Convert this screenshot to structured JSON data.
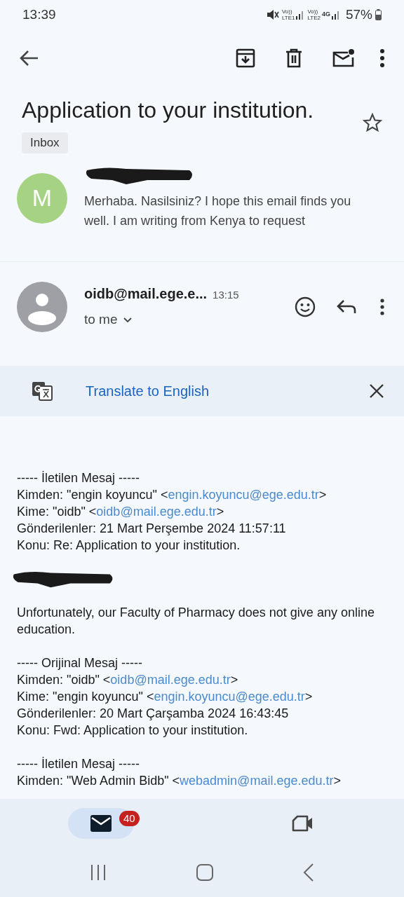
{
  "status_bar": {
    "time": "13:39",
    "networks": [
      {
        "top": "Vo))",
        "bottom": "LTE1"
      },
      {
        "top": "Vo))",
        "bottom": "LTE2",
        "extra": "4G"
      }
    ],
    "battery": "57%"
  },
  "subject": "Application to your institution.",
  "label": "Inbox",
  "starred": false,
  "messages": [
    {
      "kind": "collapsed",
      "avatar_letter": "M",
      "color": "#a5d383",
      "sender_redacted": true,
      "snippet": "Merhaba. Nasilsiniz? I hope this email finds you well. I am writing from Kenya to request"
    },
    {
      "kind": "expanded",
      "sender": "oidb@mail.ege.e...",
      "time": "13:15",
      "recipient": "to me"
    }
  ],
  "translate": {
    "label": "Translate to English"
  },
  "body": [
    [
      {
        "kind": "text",
        "text": "----- İletilen Mesaj -----"
      },
      {
        "kind": "email",
        "prefix": "Kimden: \"engin koyuncu\" <",
        "link": "engin.koyuncu@ege.edu.tr",
        "suffix": ">"
      },
      {
        "kind": "email",
        "prefix": "Kime: \"oidb\" <",
        "link": "oidb@mail.ege.edu.tr",
        "suffix": ">"
      },
      {
        "kind": "text",
        "text": "Gönderilenler: 21 Mart Perşembe 2024 11:57:11"
      },
      {
        "kind": "text",
        "text": "Konu: Re: Application to your institution."
      }
    ],
    [
      {
        "kind": "redacted"
      }
    ],
    [
      {
        "kind": "text",
        "text": "Unfortunately, our Faculty of Pharmacy does not give any online education."
      }
    ],
    [
      {
        "kind": "text",
        "text": "----- Orijinal Mesaj -----"
      },
      {
        "kind": "email",
        "prefix": "Kimden: \"oidb\" <",
        "link": "oidb@mail.ege.edu.tr",
        "suffix": ">"
      },
      {
        "kind": "email",
        "prefix": "Kime: \"engin koyuncu\" <",
        "link": "engin.koyuncu@ege.edu.tr",
        "suffix": ">"
      },
      {
        "kind": "text",
        "text": "Gönderilenler: 20 Mart Çarşamba 2024 16:43:45"
      },
      {
        "kind": "text",
        "text": "Konu: Fwd: Application to your institution."
      }
    ],
    [
      {
        "kind": "text",
        "text": "----- İletilen Mesaj -----"
      },
      {
        "kind": "email",
        "prefix": "Kimden: \"Web Admin Bidb\" <",
        "link": "webadmin@mail.ege.edu.tr",
        "suffix": ">"
      }
    ]
  ],
  "bottom_nav": [
    {
      "kind": "mail",
      "badge": "40",
      "selected": true
    },
    {
      "kind": "video",
      "selected": false
    }
  ]
}
